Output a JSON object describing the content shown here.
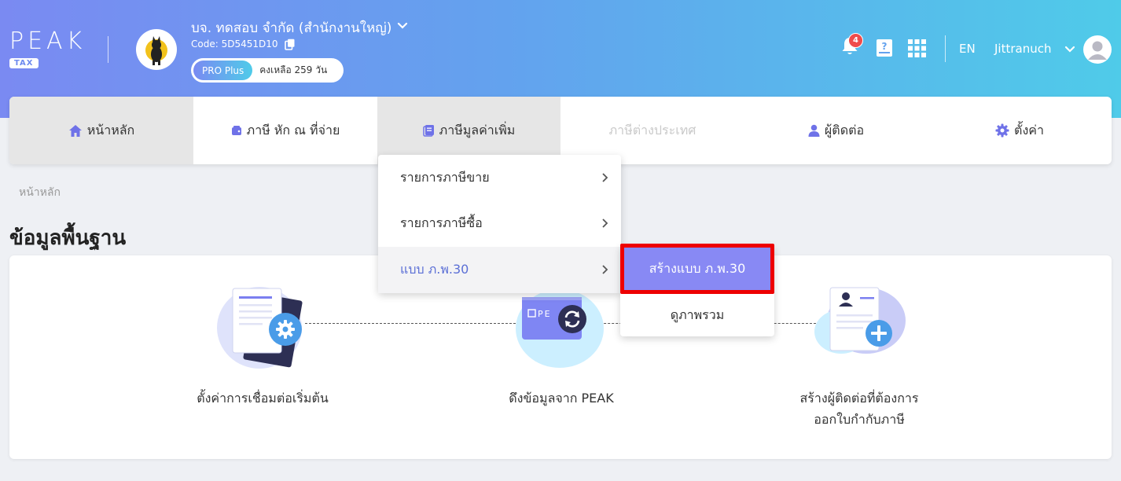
{
  "brand": {
    "logo_text": "PEAK",
    "logo_sub": "TAX"
  },
  "company": {
    "name": "บจ. ทดสอบ จำกัด (สำนักงานใหญ่)",
    "code": "Code: 5D5451D10",
    "plan": "PRO Plus",
    "remaining": "คงเหลือ 259 วัน"
  },
  "header": {
    "notification_count": "4",
    "language": "EN",
    "username": "Jittranuch"
  },
  "nav": {
    "items": [
      {
        "label": "หน้าหลัก",
        "icon": "home-icon",
        "state": "active"
      },
      {
        "label": "ภาษี หัก ณ ที่จ่าย",
        "icon": "wallet-icon",
        "state": "normal"
      },
      {
        "label": "ภาษีมูลค่าเพิ่ม",
        "icon": "document-icon",
        "state": "active"
      },
      {
        "label": "ภาษีต่างประเทศ",
        "icon": "",
        "state": "disabled"
      },
      {
        "label": "ผู้ติดต่อ",
        "icon": "user-icon",
        "state": "normal"
      },
      {
        "label": "ตั้งค่า",
        "icon": "gear-icon",
        "state": "normal"
      }
    ]
  },
  "dropdown": {
    "items": [
      {
        "label": "รายการภาษีขาย"
      },
      {
        "label": "รายการภาษีซื้อ"
      },
      {
        "label": "แบบ ภ.พ.30"
      }
    ],
    "submenu": {
      "create": "สร้างแบบ ภ.พ.30",
      "overview": "ดูภาพรวม"
    }
  },
  "page": {
    "breadcrumb": "หน้าหลัก",
    "title": "ข้อมูลพื้นฐาน",
    "steps": [
      {
        "label": "ตั้งค่าการเชื่อมต่อเริ่มต้น"
      },
      {
        "label": "ดึงข้อมูลจาก PEAK"
      },
      {
        "label_line1": "สร้างผู้ติดต่อที่ต้องการ",
        "label_line2": "ออกใบกำกับภาษี"
      }
    ]
  },
  "colors": {
    "accent": "#8889f4",
    "highlight_border": "#ee0000",
    "notification": "#ef4b4b",
    "nav_active": "#e6e6e6"
  }
}
